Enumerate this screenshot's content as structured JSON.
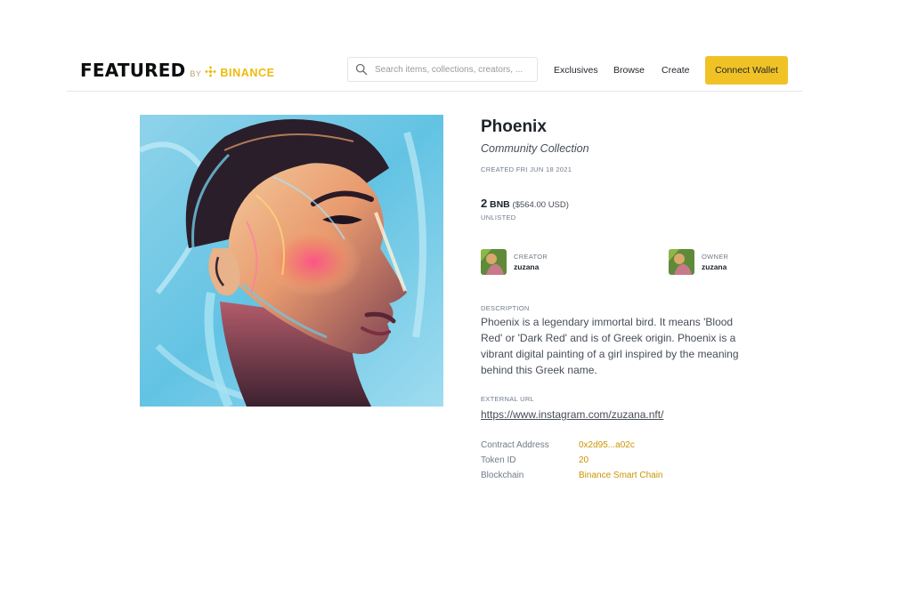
{
  "header": {
    "logo": {
      "featured": "FEATURED",
      "by": "BY",
      "binance": "BINANCE"
    },
    "search": {
      "placeholder": "Search items, collections, creators, ..."
    },
    "nav": {
      "exclusives": "Exclusives",
      "browse": "Browse",
      "create": "Create"
    },
    "connect_wallet": "Connect Wallet"
  },
  "item": {
    "title": "Phoenix",
    "collection": "Community Collection",
    "created": "CREATED FRI JUN 18 2021",
    "price": {
      "amount": "2",
      "currency": "BNB",
      "usd": "($564.00 USD)"
    },
    "listing_status": "UNLISTED",
    "creator": {
      "role": "CREATOR",
      "name": "zuzana"
    },
    "owner": {
      "role": "OWNER",
      "name": "zuzana"
    },
    "description_label": "DESCRIPTION",
    "description": "Phoenix is a legendary immortal bird. It means 'Blood Red' or 'Dark Red' and is of Greek origin. Phoenix is a vibrant digital painting of a girl inspired by the meaning behind this Greek name.",
    "external_url_label": "EXTERNAL URL",
    "external_url": "https://www.instagram.com/zuzana.nft/",
    "meta": {
      "contract_address": {
        "label": "Contract Address",
        "value": "0x2d95...a02c"
      },
      "token_id": {
        "label": "Token ID",
        "value": "20"
      },
      "blockchain": {
        "label": "Blockchain",
        "value": "Binance Smart Chain"
      }
    }
  },
  "colors": {
    "brand_yellow": "#f0b90b",
    "button_yellow": "#f0c226",
    "link_gold": "#c99400",
    "text_dark": "#1e2329",
    "text_muted": "#707a8a"
  },
  "icons": [
    "binance-logo-icon",
    "search-icon"
  ]
}
